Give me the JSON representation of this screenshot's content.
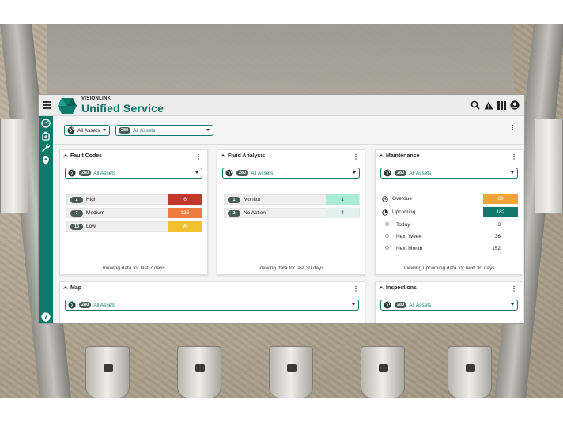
{
  "app": {
    "brand_small": "VISIONLINK",
    "title": "Unified Service"
  },
  "filters": {
    "scope_label": "All Assets",
    "asset_count": "280",
    "asset_label": "All Assets"
  },
  "cards": {
    "fault_codes": {
      "title": "Fault Codes",
      "count": "280",
      "select_label": "All Assets",
      "rows": [
        {
          "count": "2",
          "label": "High",
          "value": "6",
          "color": "#c0392b"
        },
        {
          "count": "7",
          "label": "Medium",
          "value": "135",
          "color": "#f07b3f"
        },
        {
          "count": "13",
          "label": "Low",
          "value": "99",
          "color": "#f2c12e"
        }
      ],
      "footer": "Viewing data for last 7 days"
    },
    "fluid_analysis": {
      "title": "Fluid Analysis",
      "count": "280",
      "select_label": "All Assets",
      "rows": [
        {
          "count": "1",
          "label": "Monitor",
          "value": "1",
          "color": "#a9ecd6"
        },
        {
          "count": "2",
          "label": "No Action",
          "value": "4",
          "color": "#e3f1ee"
        }
      ],
      "footer": "Viewing data for last 30 days"
    },
    "maintenance": {
      "title": "Maintenance",
      "count": "280",
      "select_label": "All Assets",
      "overdue_label": "Overdue",
      "overdue_value": "89",
      "upcoming_label": "Upcoming",
      "upcoming_value": "182",
      "breakdown": [
        {
          "label": "Today",
          "value": "3"
        },
        {
          "label": "Next Week",
          "value": "36"
        },
        {
          "label": "Next Month",
          "value": "152"
        }
      ],
      "footer": "Viewing upcoming data for next 30 days"
    },
    "map": {
      "title": "Map",
      "count": "280",
      "select_label": "All Assets"
    },
    "inspections": {
      "title": "Inspections",
      "count": "280",
      "select_label": "All Assets"
    }
  },
  "colors": {
    "brand": "#0f7a6c",
    "overdue": "#f0a33a",
    "upcoming": "#0f7a6c"
  }
}
